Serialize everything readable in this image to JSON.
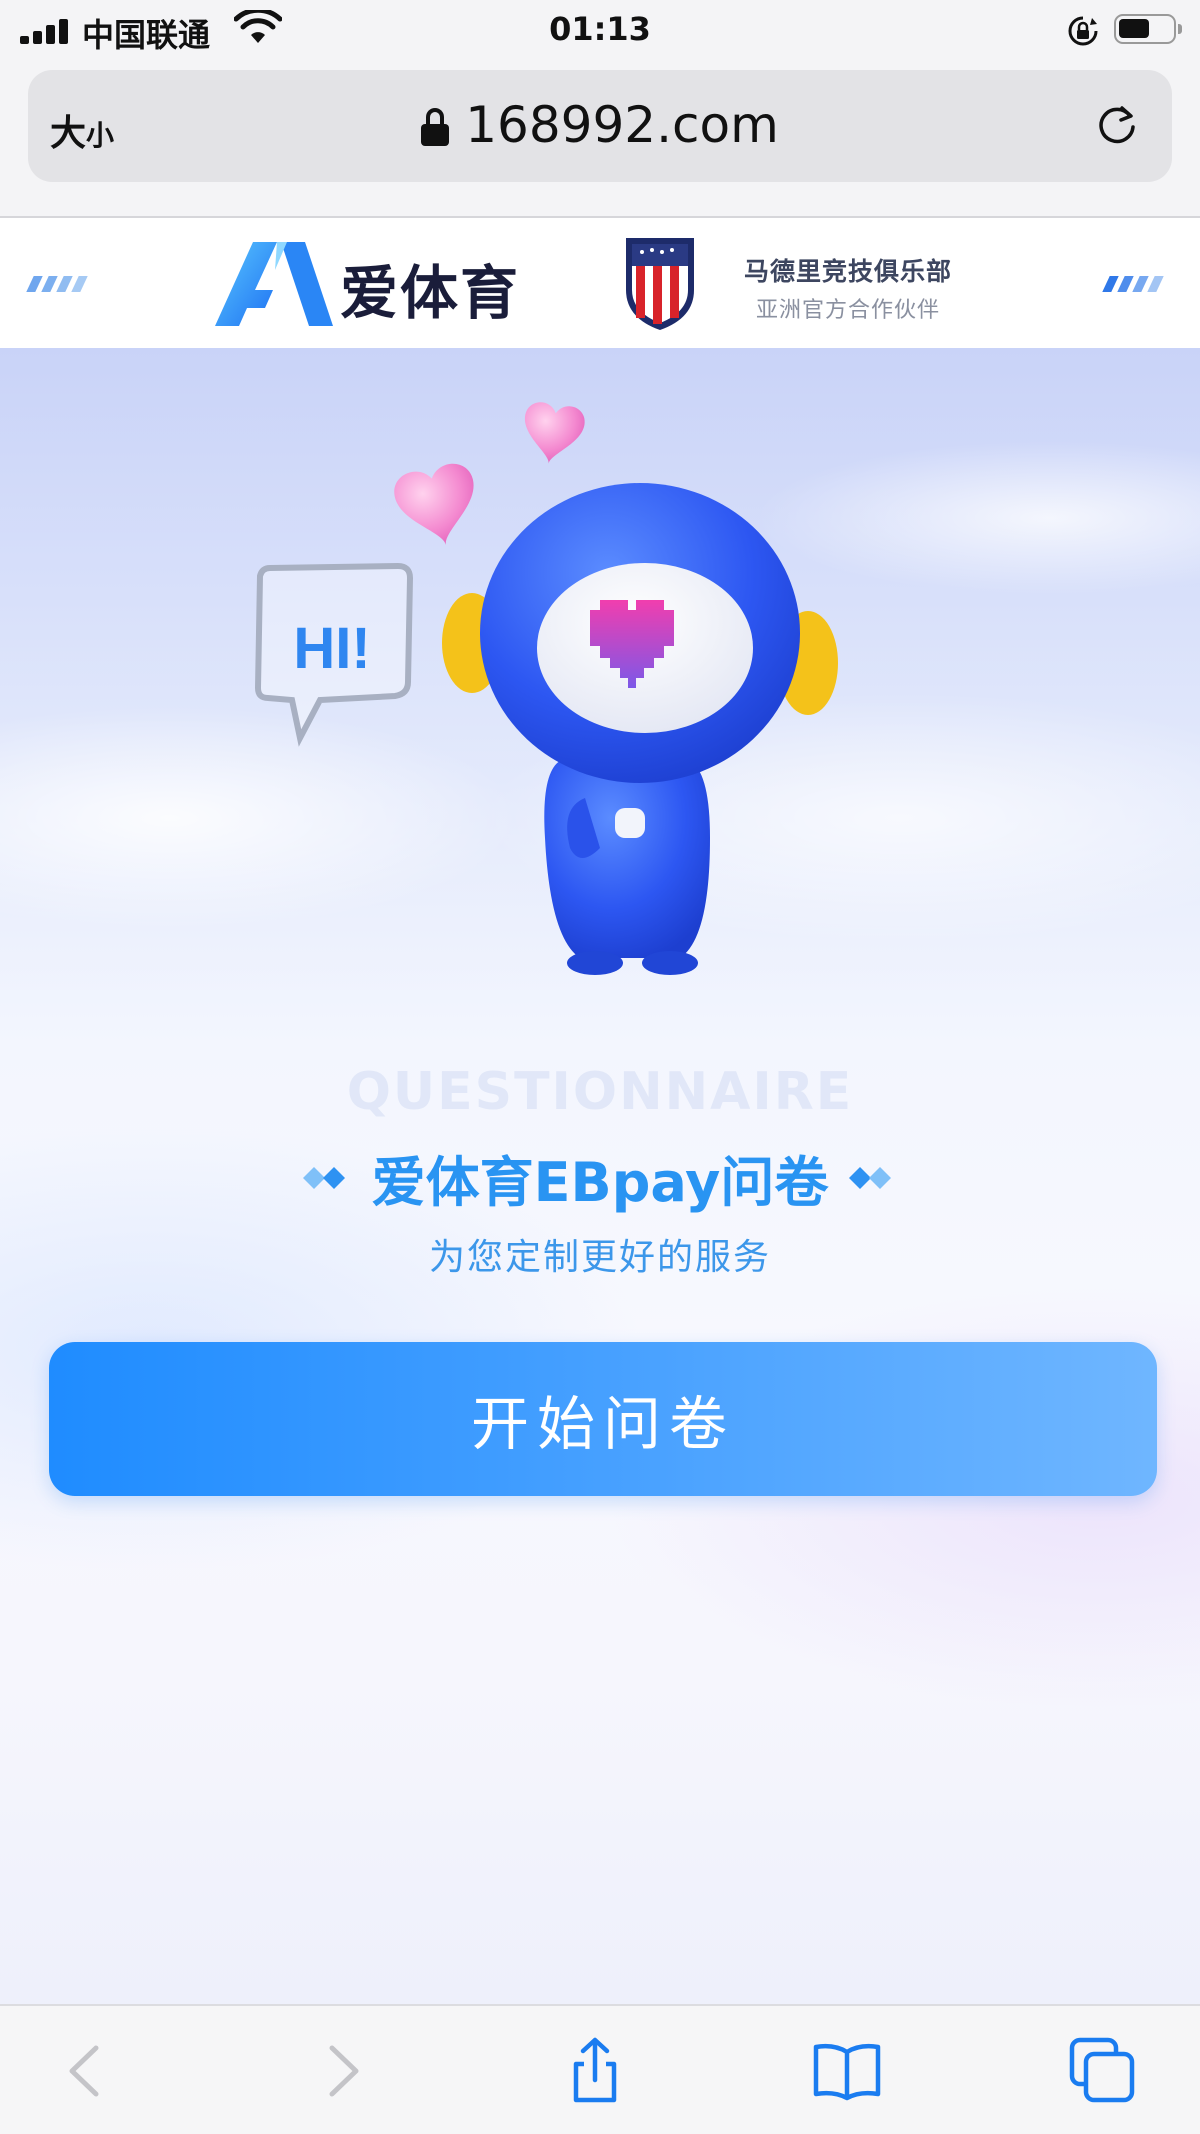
{
  "status_bar": {
    "carrier": "中国联通",
    "time": "01:13",
    "icons": [
      "signal-icon",
      "wifi-icon",
      "rotation-lock-icon",
      "battery-icon"
    ]
  },
  "address_bar": {
    "text_size_label_large": "大",
    "text_size_label_small": "小",
    "url": "168992.com",
    "icons": [
      "lock-icon",
      "reload-icon"
    ]
  },
  "site_header": {
    "brand_name": "爱体育",
    "club_name": "马德里竞技俱乐部",
    "club_subtitle": "亚洲官方合作伙伴",
    "icons": [
      "brand-logo-icon",
      "club-crest-icon"
    ]
  },
  "hero": {
    "bubble_text": "HI!",
    "watermark": "QUESTIONNAIRE",
    "title": "爱体育EBpay问卷",
    "subtitle": "为您定制更好的服务",
    "start_button_label": "开始问卷"
  },
  "toolbar": {
    "icons": [
      "back-icon",
      "forward-icon",
      "share-icon",
      "bookmarks-icon",
      "tabs-icon"
    ]
  },
  "colors": {
    "accent_blue": "#2994f2",
    "button_start": "#1f8cff",
    "button_end": "#6fb6ff",
    "brand_dark": "#1a1d3a",
    "ios_link_blue": "#1a7cf0"
  }
}
